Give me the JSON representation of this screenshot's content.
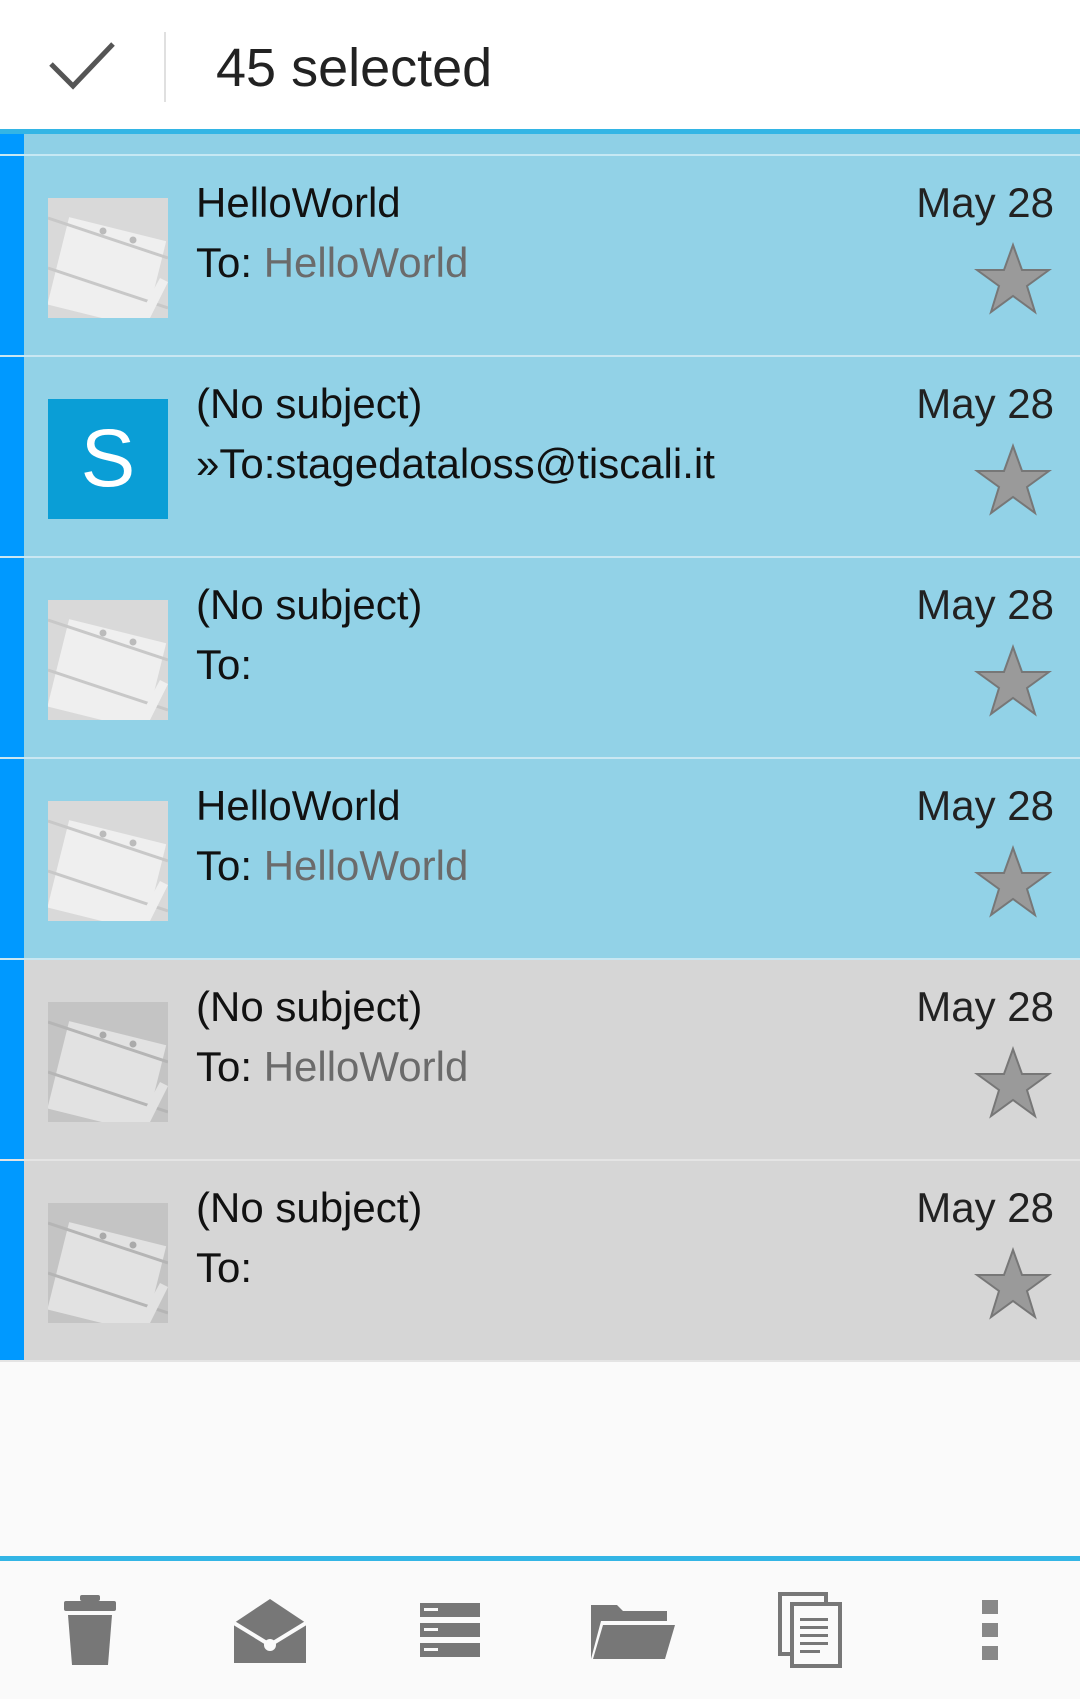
{
  "action_bar": {
    "done_icon": "checkmark-icon",
    "title": "45 selected"
  },
  "colors": {
    "accent": "#33b5e5",
    "selection_bar": "#0099ff",
    "selected_row": "#92d2e7",
    "unselected_row": "#d6d6d6",
    "letter_avatar": "#0a9ed6"
  },
  "messages": [
    {
      "subject": "HelloWorld",
      "to_prefix": "To: ",
      "to_name": "HelloWorld",
      "date": "May 28",
      "avatar": "android-avatar-icon",
      "selected": true
    },
    {
      "subject": "(No subject)",
      "to_prefix": "»To:stagedataloss@tiscali.it",
      "to_name": "",
      "date": "May 28",
      "avatar_letter": "S",
      "selected": true
    },
    {
      "subject": "(No subject)",
      "to_prefix": "To:",
      "to_name": "",
      "date": "May 28",
      "avatar": "android-avatar-icon",
      "selected": true
    },
    {
      "subject": "HelloWorld",
      "to_prefix": "To: ",
      "to_name": "HelloWorld",
      "date": "May 28",
      "avatar": "android-avatar-icon",
      "selected": true
    },
    {
      "subject": "(No subject)",
      "to_prefix": "To: ",
      "to_name": "HelloWorld",
      "date": "May 28",
      "avatar": "android-avatar-icon",
      "selected": false
    },
    {
      "subject": "(No subject)",
      "to_prefix": "To:",
      "to_name": "",
      "date": "May 28",
      "avatar": "android-avatar-icon",
      "selected": false
    }
  ],
  "bottom_bar": {
    "items": [
      "trash-icon",
      "mark-read-icon",
      "stack-icon",
      "folder-icon",
      "copy-icon",
      "overflow-menu-icon"
    ]
  }
}
